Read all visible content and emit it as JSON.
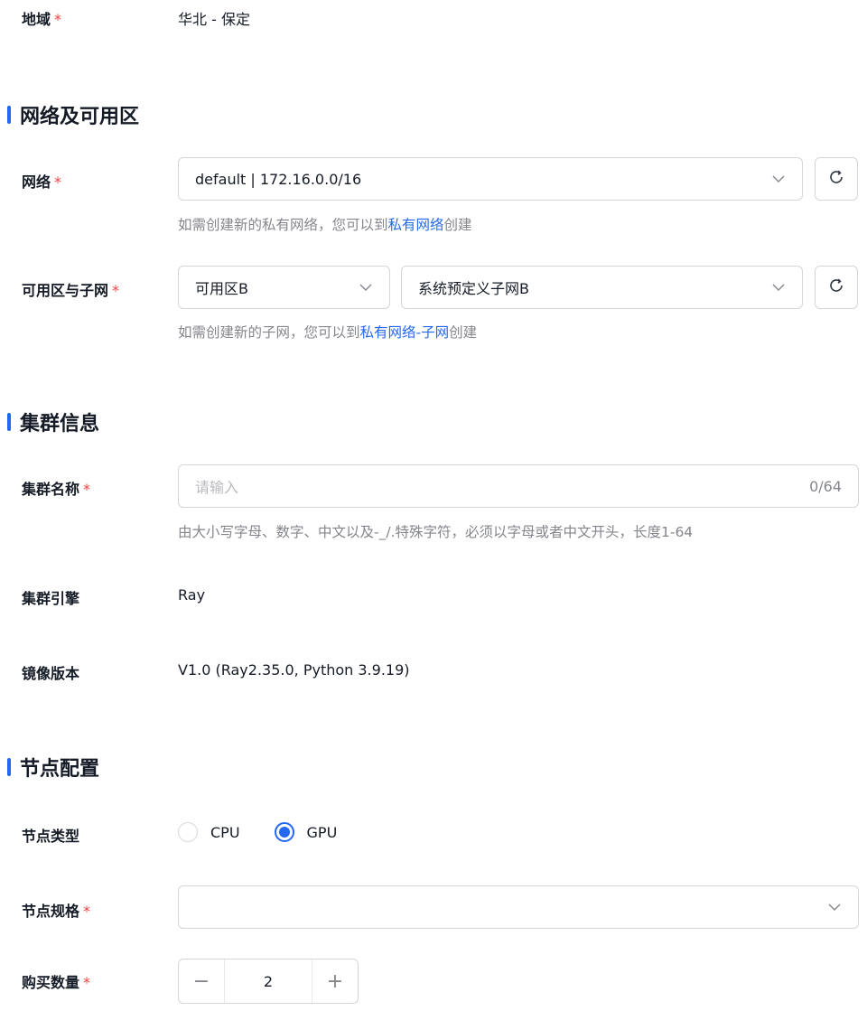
{
  "region": {
    "label": "地域",
    "required_mark": "*",
    "value": "华北 - 保定"
  },
  "network_section": {
    "title": "网络及可用区",
    "network": {
      "label": "网络",
      "required_mark": "*",
      "selected": "default | 172.16.0.0/16",
      "hint_prefix": "如需创建新的私有网络，您可以到",
      "hint_link": "私有网络",
      "hint_suffix": "创建"
    },
    "zone_subnet": {
      "label": "可用区与子网",
      "required_mark": "*",
      "zone_selected": "可用区B",
      "subnet_selected": "系统预定义子网B",
      "hint_prefix": "如需创建新的子网，您可以到",
      "hint_link": "私有网络-子网",
      "hint_suffix": "创建"
    }
  },
  "cluster_section": {
    "title": "集群信息",
    "name": {
      "label": "集群名称",
      "required_mark": "*",
      "placeholder": "请输入",
      "counter": "0/64",
      "hint": "由大小写字母、数字、中文以及-_/.特殊字符，必须以字母或者中文开头，长度1-64"
    },
    "engine": {
      "label": "集群引擎",
      "value": "Ray"
    },
    "image": {
      "label": "镜像版本",
      "value": "V1.0 (Ray2.35.0, Python 3.9.19)"
    }
  },
  "node_section": {
    "title": "节点配置",
    "node_type": {
      "label": "节点类型",
      "options": [
        "CPU",
        "GPU"
      ],
      "selected": "GPU"
    },
    "node_spec": {
      "label": "节点规格",
      "required_mark": "*",
      "selected": ""
    },
    "quantity": {
      "label": "购买数量",
      "required_mark": "*",
      "value": "2",
      "minus": "−",
      "plus": "+"
    }
  },
  "colors": {
    "accent": "#2468f2",
    "required": "#f33e3e",
    "hint": "#84868c",
    "border": "#d4d6d9"
  },
  "icons": {
    "refresh": "refresh-icon",
    "chevron": "chevron-down-icon"
  }
}
